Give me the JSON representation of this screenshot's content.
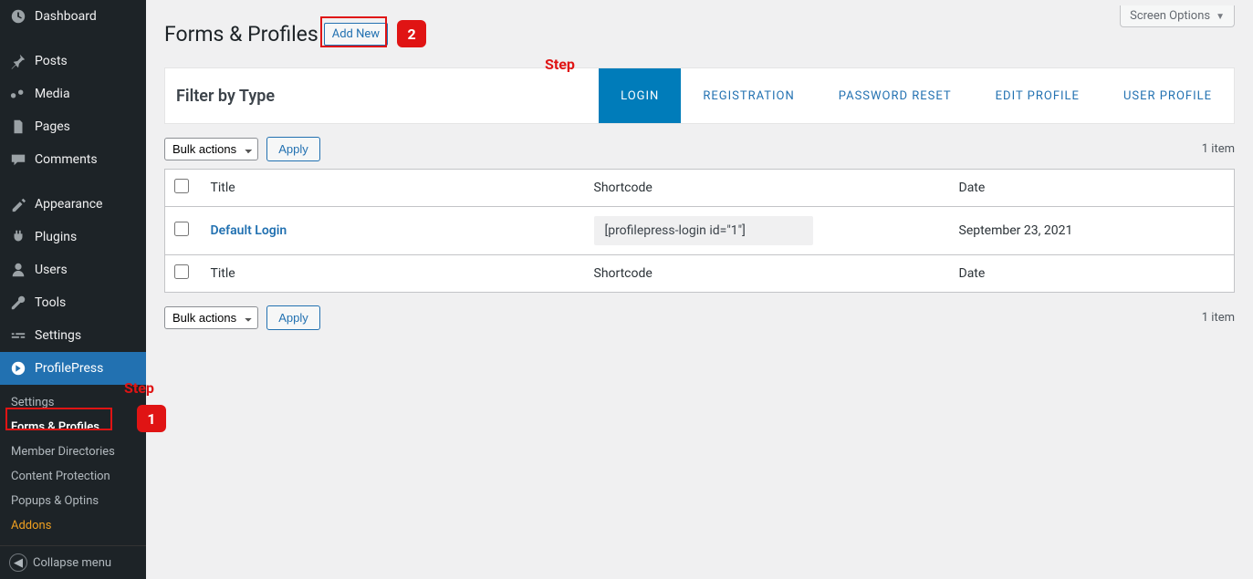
{
  "sidebar": {
    "items": [
      {
        "label": "Dashboard"
      },
      {
        "label": "Posts"
      },
      {
        "label": "Media"
      },
      {
        "label": "Pages"
      },
      {
        "label": "Comments"
      },
      {
        "label": "Appearance"
      },
      {
        "label": "Plugins"
      },
      {
        "label": "Users"
      },
      {
        "label": "Tools"
      },
      {
        "label": "Settings"
      },
      {
        "label": "ProfilePress"
      }
    ],
    "submenu": [
      {
        "label": "Settings"
      },
      {
        "label": "Forms & Profiles"
      },
      {
        "label": "Member Directories"
      },
      {
        "label": "Content Protection"
      },
      {
        "label": "Popups & Optins"
      },
      {
        "label": "Addons"
      }
    ],
    "collapse": "Collapse menu"
  },
  "header": {
    "screen_options": "Screen Options",
    "page_title": "Forms & Profiles",
    "add_new": "Add New"
  },
  "annotations": {
    "step_word": "Step",
    "step1": "1",
    "step2": "2"
  },
  "filter": {
    "title": "Filter by Type",
    "tabs": [
      "LOGIN",
      "REGISTRATION",
      "PASSWORD RESET",
      "EDIT PROFILE",
      "USER PROFILE"
    ]
  },
  "list": {
    "bulk_label": "Bulk actions",
    "apply": "Apply",
    "count": "1 item",
    "columns": {
      "title": "Title",
      "shortcode": "Shortcode",
      "date": "Date"
    },
    "rows": [
      {
        "title": "Default Login",
        "shortcode": "[profilepress-login id=\"1\"]",
        "date": "September 23, 2021"
      }
    ]
  }
}
